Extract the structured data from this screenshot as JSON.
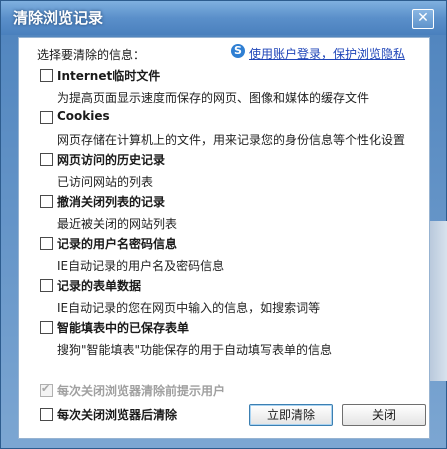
{
  "window": {
    "title": "清除浏览记录",
    "close_symbol": "✕"
  },
  "header": {
    "label": "选择要清除的信息：",
    "link_text": "使用账户登录，保护浏览隐私",
    "logo_letter": "S"
  },
  "options": [
    {
      "label": "Internet临时文件",
      "description": "为提高页面显示速度而保存的网页、图像和媒体的缓存文件",
      "checked": false
    },
    {
      "label": "Cookies",
      "description": "网页存储在计算机上的文件，用来记录您的身份信息等个性化设置",
      "checked": false
    },
    {
      "label": "网页访问的历史记录",
      "description": "已访问网站的列表",
      "checked": false
    },
    {
      "label": "撤消关闭列表的记录",
      "description": "最近被关闭的网站列表",
      "checked": false
    },
    {
      "label": "记录的用户名密码信息",
      "description": "IE自动记录的用户名及密码信息",
      "checked": false
    },
    {
      "label": "记录的表单数据",
      "description": "IE自动记录的您在网页中输入的信息，如搜索词等",
      "checked": false
    },
    {
      "label": "智能填表中的已保存表单",
      "description": "搜狗\"智能填表\"功能保存的用于自动填写表单的信息",
      "checked": false
    }
  ],
  "footer": {
    "prompt_label": "每次关闭浏览器清除前提示用户",
    "prompt_checked": true,
    "prompt_disabled": true,
    "autoclear_label": "每次关闭浏览器后清除",
    "autoclear_checked": false,
    "clear_button": "立即清除",
    "close_button": "关闭"
  }
}
